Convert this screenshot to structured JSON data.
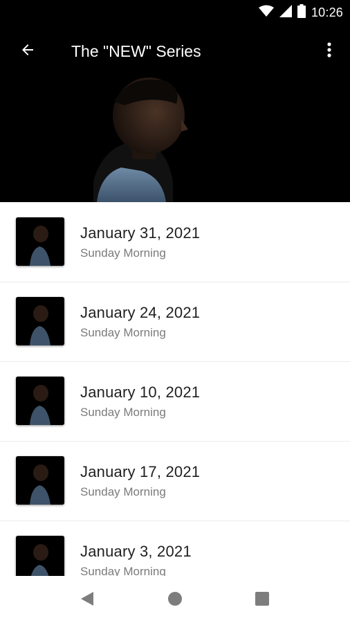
{
  "status_bar": {
    "time": "10:26",
    "icons": [
      "wifi-icon",
      "cell-signal-icon",
      "battery-icon"
    ]
  },
  "app_bar": {
    "title": "The \"NEW\" Series",
    "back_icon": "arrow-back-icon",
    "menu_icon": "more-vert-icon"
  },
  "hero": {
    "image": "man-profile-photo"
  },
  "sermons": [
    {
      "date": "January 31, 2021",
      "service": "Sunday Morning"
    },
    {
      "date": "January 24, 2021",
      "service": "Sunday Morning"
    },
    {
      "date": "January 10, 2021",
      "service": "Sunday Morning"
    },
    {
      "date": "January 17, 2021",
      "service": "Sunday Morning"
    },
    {
      "date": "January 3, 2021",
      "service": "Sunday Morning"
    }
  ],
  "nav_bar": {
    "icons": [
      "back-triangle-icon",
      "home-circle-icon",
      "recents-square-icon"
    ]
  },
  "colors": {
    "app_bar": "#000000",
    "title_text": "#1f1f1f",
    "subtitle_text": "#7a7a7a",
    "nav_icon": "#7d7d7d"
  }
}
